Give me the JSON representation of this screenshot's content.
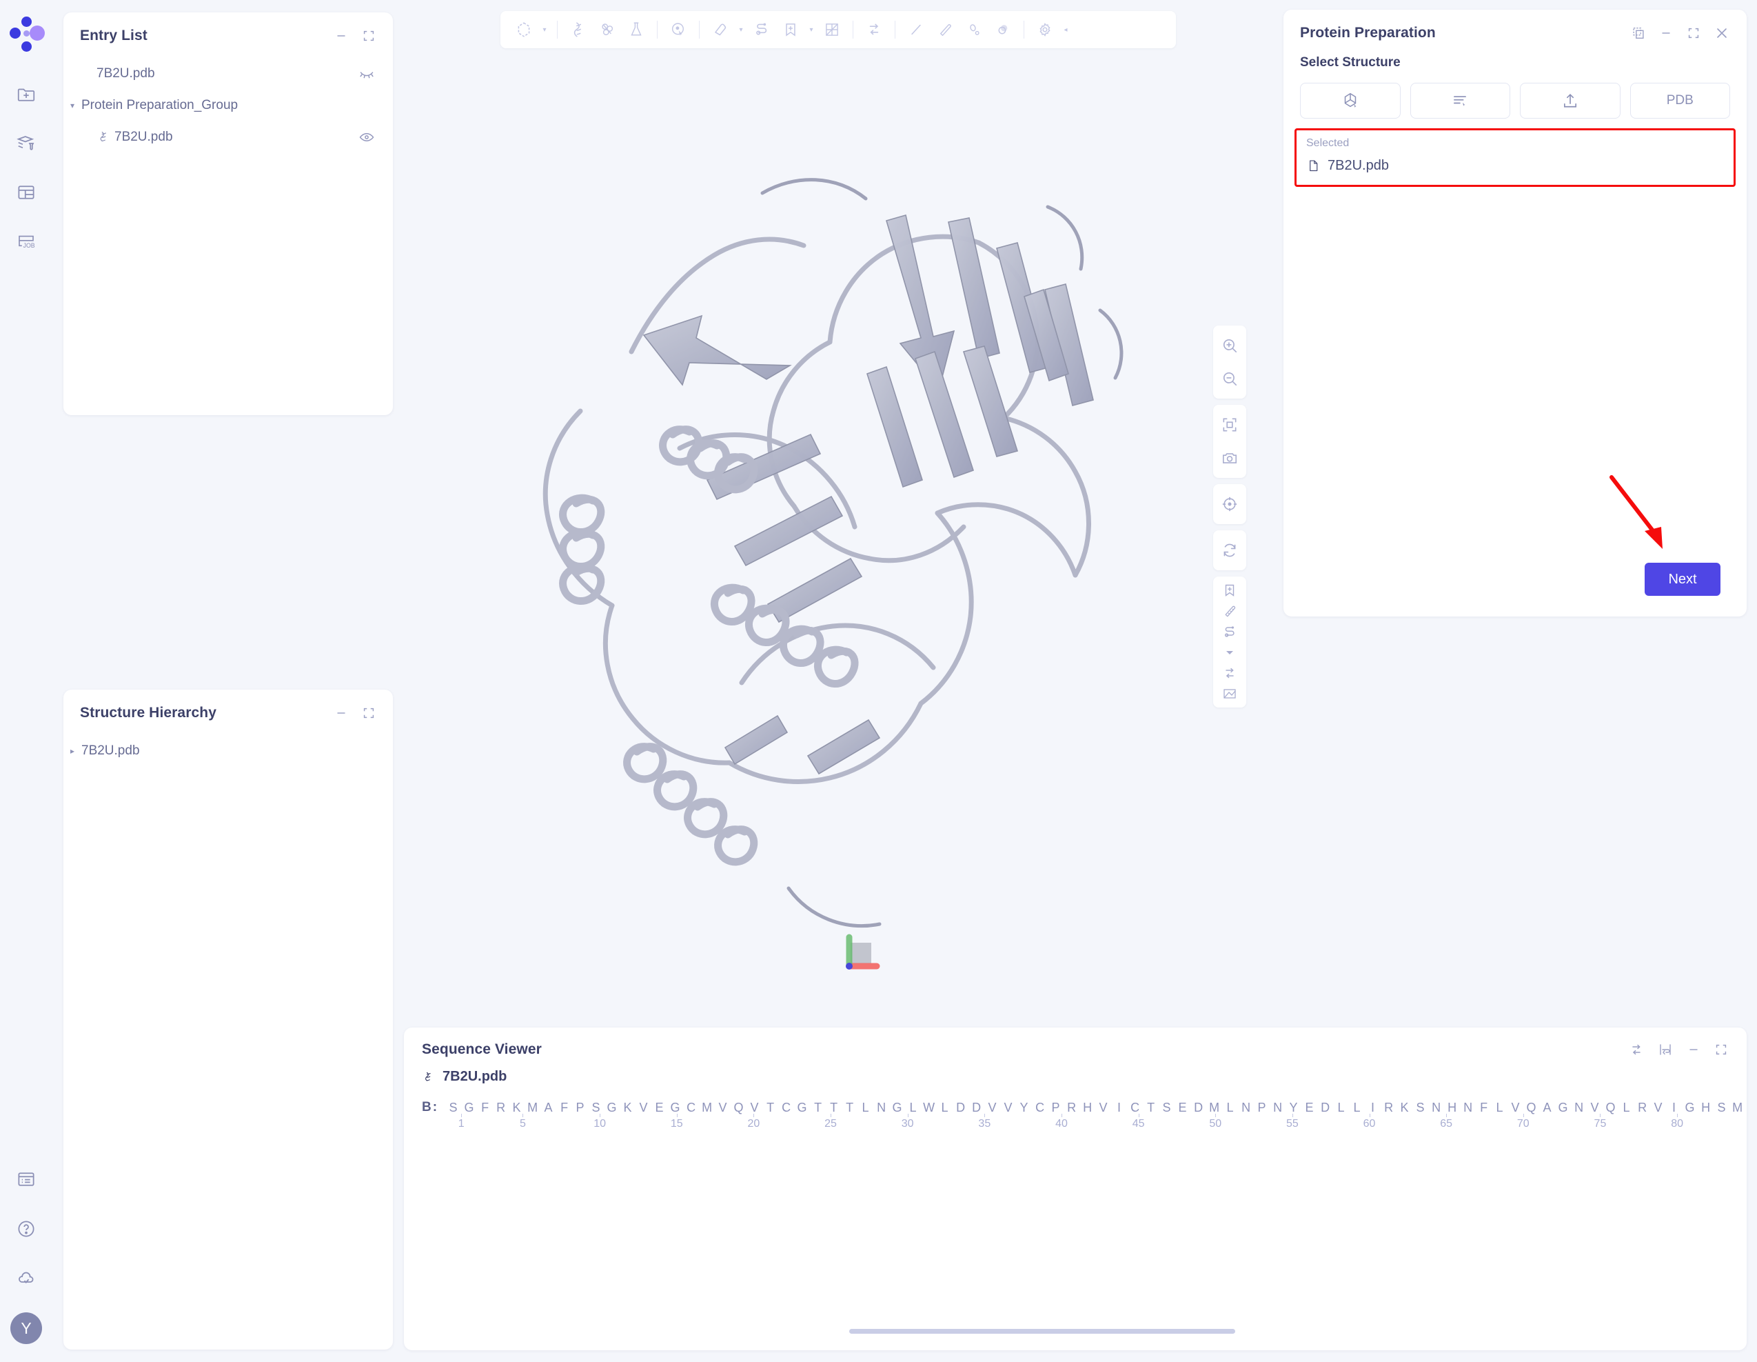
{
  "rail": {
    "logo_name": "app-logo",
    "top_items": [
      {
        "name": "new-project-icon",
        "title": "New Project"
      },
      {
        "name": "workflow-library-icon",
        "title": "Workflow Library"
      },
      {
        "name": "table-view-icon",
        "title": "Table View"
      },
      {
        "name": "job-icon",
        "title": "Jobs"
      }
    ],
    "bottom_items": [
      {
        "name": "notes-icon",
        "title": "Notes"
      },
      {
        "name": "help-icon",
        "title": "Help"
      },
      {
        "name": "cloud-sync-icon",
        "title": "Cloud Sync"
      }
    ],
    "avatar_initial": "Y"
  },
  "entry_list": {
    "title": "Entry List",
    "minimize_label": "—",
    "expand_label": "expand",
    "rows": [
      {
        "label": "7B2U.pdb",
        "indent": 1,
        "caret": "",
        "icon": "",
        "eye": "hidden"
      },
      {
        "label": "Protein Preparation_Group",
        "indent": 0,
        "caret": "▾",
        "icon": "",
        "eye": ""
      },
      {
        "label": "7B2U.pdb",
        "indent": 1,
        "caret": "",
        "icon": "molecule",
        "eye": "visible"
      }
    ]
  },
  "structure_hierarchy": {
    "title": "Structure Hierarchy",
    "rows": [
      {
        "label": "7B2U.pdb",
        "caret": "▸"
      }
    ]
  },
  "viewport": {
    "toolbar": [
      {
        "name": "selection-shape-icon",
        "caret": true
      },
      {
        "sep": true
      },
      {
        "name": "ribbon-representation-icon",
        "caret": false
      },
      {
        "name": "surface-representation-icon",
        "caret": false
      },
      {
        "name": "ligand-flask-icon",
        "caret": false
      },
      {
        "sep": true
      },
      {
        "name": "pick-atom-icon",
        "caret": false
      },
      {
        "sep": true
      },
      {
        "name": "eraser-icon",
        "caret": true
      },
      {
        "name": "link-path-icon",
        "caret": false
      },
      {
        "name": "bookmark-add-icon",
        "caret": true
      },
      {
        "name": "grid-box-icon",
        "caret": false
      },
      {
        "sep": true
      },
      {
        "name": "swap-arrows-icon",
        "caret": false
      },
      {
        "sep": true
      },
      {
        "name": "line-tool-icon",
        "caret": false
      },
      {
        "name": "ruler-tool-icon",
        "caret": false
      },
      {
        "name": "angle-tool-icon",
        "caret": false
      },
      {
        "name": "sphere-tool-icon",
        "caret": false
      },
      {
        "sep": true
      },
      {
        "name": "settings-gear-icon",
        "caret": false
      }
    ],
    "collapse_arrow": "◂",
    "side_tools": [
      [
        {
          "name": "zoom-in-icon"
        },
        {
          "name": "zoom-out-icon"
        }
      ],
      [
        {
          "name": "fit-to-screen-icon"
        },
        {
          "name": "camera-snapshot-icon"
        }
      ],
      [
        {
          "name": "center-target-icon"
        }
      ],
      [
        {
          "name": "reset-rotation-icon"
        }
      ],
      [
        {
          "name": "bookmark-add-icon"
        },
        {
          "name": "measure-ruler-icon"
        },
        {
          "name": "path-distance-icon"
        },
        {
          "name": "dropdown-caret-icon"
        },
        {
          "name": "swap-arrows-icon"
        },
        {
          "name": "map-surface-icon"
        }
      ]
    ],
    "axis_gizmo": {
      "x_color": "#f2534f",
      "y_color": "#63b96a",
      "z_color": "#4747d8"
    }
  },
  "protein_preparation": {
    "title": "Protein Preparation",
    "window_tools": [
      {
        "name": "popout-window-icon"
      },
      {
        "name": "minimize-icon"
      },
      {
        "name": "maximize-icon"
      },
      {
        "name": "close-icon"
      }
    ],
    "subtitle": "Select Structure",
    "source_buttons": [
      {
        "name": "from-workspace-button",
        "label": "",
        "icon": "molecule-pick-icon"
      },
      {
        "name": "from-list-button",
        "label": "",
        "icon": "list-pick-icon"
      },
      {
        "name": "upload-button",
        "label": "",
        "icon": "upload-icon"
      },
      {
        "name": "pdb-button",
        "label": "PDB",
        "icon": ""
      }
    ],
    "selected_label": "Selected",
    "selected_file": "7B2U.pdb",
    "clear_icon": "clear-circle-icon",
    "next_label": "Next",
    "highlight_color": "#f50c0c",
    "accent_color": "#4f46e5"
  },
  "sequence_viewer": {
    "title": "Sequence Viewer",
    "tools": [
      {
        "name": "swap-arrows-icon"
      },
      {
        "name": "wrap-lines-icon"
      },
      {
        "name": "minimize-icon"
      },
      {
        "name": "maximize-icon"
      }
    ],
    "file_label": "7B2U.pdb",
    "chain_label": "B:",
    "sequence": "SGFRKMAFPSGKVEGCMVQVTCGTTTLNGLWLDDVVYCPRHVICTSEDMLNPNYEDLLIRKSNHNFLVQAGNVQLRVIGHSMQN",
    "tick_positions": [
      1,
      5,
      10,
      15,
      20,
      25,
      30,
      35,
      40,
      45,
      50,
      55,
      60,
      65,
      70,
      75,
      80
    ]
  }
}
